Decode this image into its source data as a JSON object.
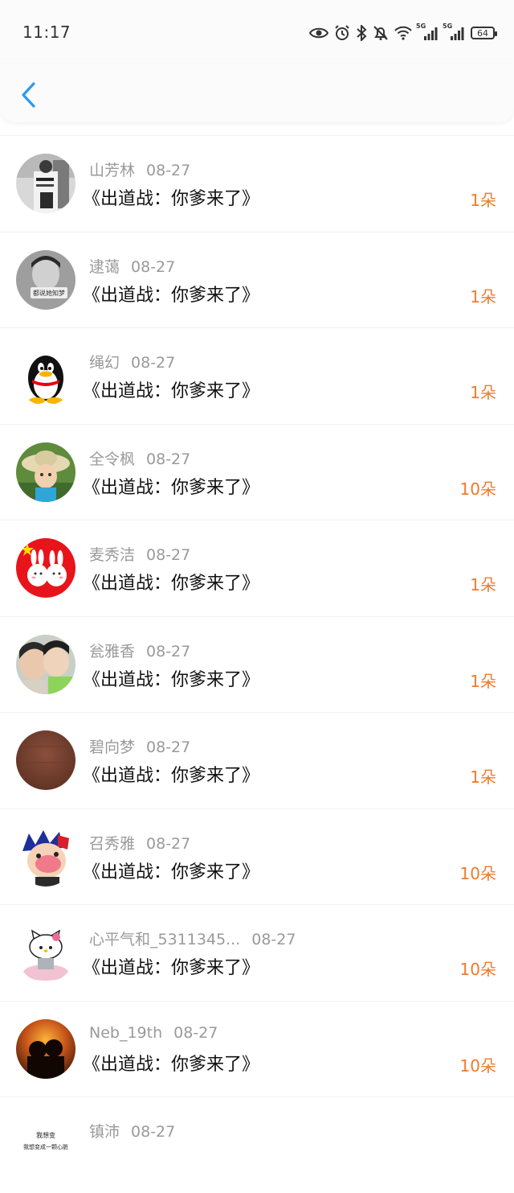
{
  "status_bar": {
    "time": "11:17",
    "network_label_1": "5G",
    "network_label_2": "5G",
    "battery": "64"
  },
  "header": {
    "back_icon": "chevron-left-icon"
  },
  "accent_color": "#2a9bf0",
  "count_color": "#f07a2b",
  "items": [
    {
      "name": "山芳林",
      "date": "08-27",
      "title": "《出道战：你爹来了》",
      "count": "1朵"
    },
    {
      "name": "逮蔼",
      "date": "08-27",
      "title": "《出道战：你爹来了》",
      "count": "1朵",
      "avatar_text": "都说她知梦"
    },
    {
      "name": "绳幻",
      "date": "08-27",
      "title": "《出道战：你爹来了》",
      "count": "1朵"
    },
    {
      "name": "全令枫",
      "date": "08-27",
      "title": "《出道战：你爹来了》",
      "count": "10朵"
    },
    {
      "name": "麦秀洁",
      "date": "08-27",
      "title": "《出道战：你爹来了》",
      "count": "1朵"
    },
    {
      "name": "瓮雅香",
      "date": "08-27",
      "title": "《出道战：你爹来了》",
      "count": "1朵"
    },
    {
      "name": "碧向梦",
      "date": "08-27",
      "title": "《出道战：你爹来了》",
      "count": "1朵"
    },
    {
      "name": "召秀雅",
      "date": "08-27",
      "title": "《出道战：你爹来了》",
      "count": "10朵"
    },
    {
      "name": "心平气和_5311345...",
      "date": "08-27",
      "title": "《出道战：你爹来了》",
      "count": "10朵"
    },
    {
      "name": "Neb_19th",
      "date": "08-27",
      "title": "《出道战：你爹来了》",
      "count": "10朵"
    },
    {
      "name": "镇沛",
      "date": "08-27",
      "title": "",
      "count": "",
      "avatar_text_1": "我想变",
      "avatar_text_2": "我想变成一颗心脏"
    }
  ]
}
